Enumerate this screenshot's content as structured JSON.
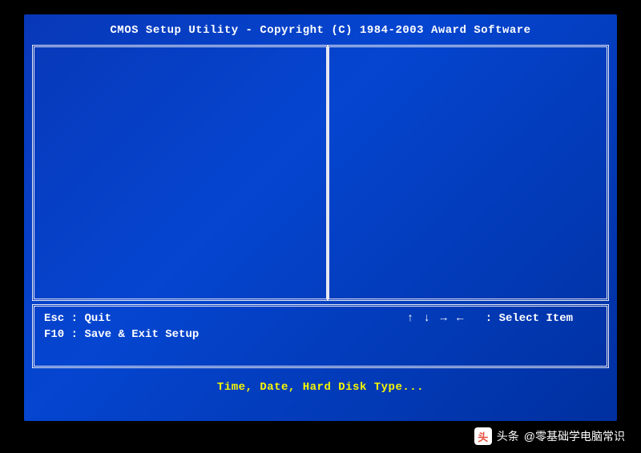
{
  "header": {
    "title": "CMOS Setup Utility - Copyright (C) 1984-2003 Award Software"
  },
  "help": {
    "esc_key": "Esc",
    "esc_label": "Quit",
    "f10_key": "F10",
    "f10_label": "Save & Exit Setup",
    "nav_arrows": "↑ ↓ → ←",
    "nav_label": "Select Item"
  },
  "footer": {
    "hint": "Time, Date, Hard Disk Type..."
  },
  "watermark": {
    "source_prefix": "头条",
    "account": "@零基础学电脑常识"
  }
}
